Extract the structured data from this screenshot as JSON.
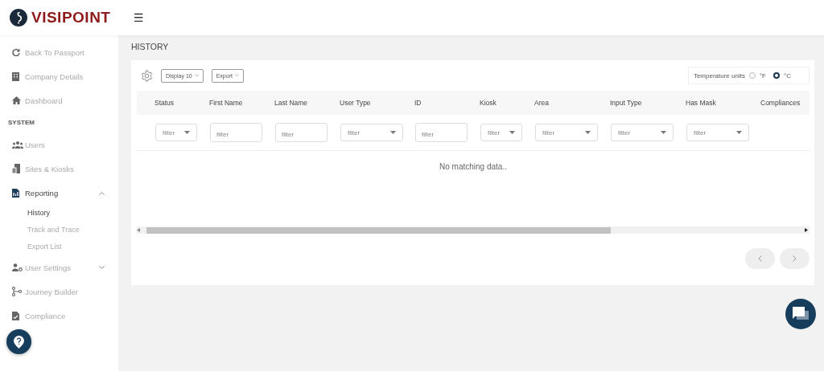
{
  "header": {
    "logo_text": "VISIPOINT",
    "menu_glyph": "☰"
  },
  "sidebar": {
    "items": [
      {
        "kind": "link",
        "label": "Back To Passport",
        "selected": false
      },
      {
        "kind": "link",
        "label": "Company Details",
        "selected": false
      },
      {
        "kind": "link",
        "label": "Dashboard",
        "selected": false
      },
      {
        "kind": "section",
        "label": "SYSTEM"
      },
      {
        "kind": "link",
        "label": "Users",
        "selected": false
      },
      {
        "kind": "link",
        "label": "Sites & Kiosks",
        "selected": false
      },
      {
        "kind": "group",
        "label": "Reporting",
        "selected": true,
        "expanded": true,
        "children": [
          {
            "label": "History",
            "selected": true
          },
          {
            "label": "Track and Trace",
            "selected": false
          },
          {
            "label": "Export List",
            "selected": false
          }
        ]
      },
      {
        "kind": "group",
        "label": "User Settings",
        "selected": false,
        "expanded": false
      },
      {
        "kind": "link",
        "label": "Journey Builder",
        "selected": false
      },
      {
        "kind": "link",
        "label": "Compliance",
        "selected": false
      }
    ]
  },
  "page_title": "HISTORY",
  "toolbar": {
    "buttons": [
      "Display 10",
      "Export"
    ],
    "temperature_label": "Temperature units",
    "units": [
      {
        "label": "°F",
        "selected": false
      },
      {
        "label": "°C",
        "selected": true
      }
    ]
  },
  "table": {
    "columns": [
      {
        "label": "Status",
        "filter": {
          "kind": "select",
          "placeholder": "filter"
        }
      },
      {
        "label": "First Name",
        "filter": {
          "kind": "text",
          "placeholder": "filter"
        }
      },
      {
        "label": "Last Name",
        "filter": {
          "kind": "text",
          "placeholder": "filter"
        }
      },
      {
        "label": "User Type",
        "filter": {
          "kind": "select",
          "placeholder": "filter"
        }
      },
      {
        "label": "ID",
        "filter": {
          "kind": "text",
          "placeholder": "filter"
        }
      },
      {
        "label": "Kiosk",
        "filter": {
          "kind": "select",
          "placeholder": "filter"
        }
      },
      {
        "label": "Area",
        "filter": {
          "kind": "select",
          "placeholder": "filter"
        }
      },
      {
        "label": "Input Type",
        "filter": {
          "kind": "select",
          "placeholder": "filter"
        }
      },
      {
        "label": "Has Mask",
        "filter": {
          "kind": "select",
          "placeholder": "filter"
        }
      },
      {
        "label": "Compliances"
      }
    ],
    "empty_message": "No matching data.."
  }
}
